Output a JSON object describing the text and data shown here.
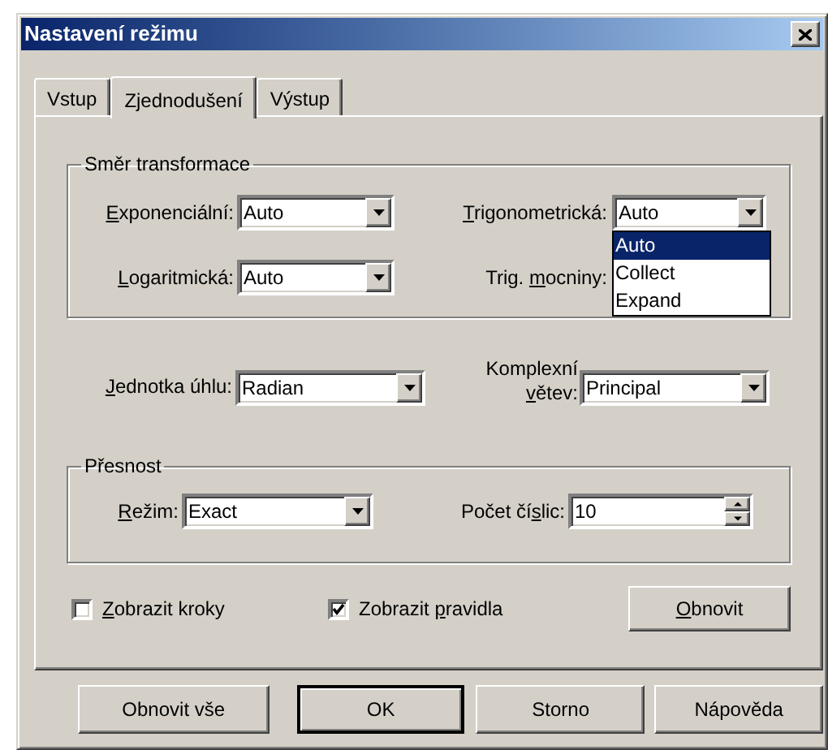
{
  "window": {
    "title": "Nastavení režimu"
  },
  "tabs": [
    {
      "label": "Vstup",
      "selected": false
    },
    {
      "label": "Zjednodušení",
      "selected": true
    },
    {
      "label": "Výstup",
      "selected": false
    }
  ],
  "transform_group": {
    "title": "Směr transformace",
    "exponential": {
      "label": {
        "key": "E",
        "post": "xponenciální:"
      },
      "value": "Auto"
    },
    "trigonometric": {
      "label": {
        "key": "T",
        "post": "rigonometrická:"
      },
      "value": "Auto",
      "expanded": true,
      "options": [
        {
          "label": "Auto",
          "selected": true
        },
        {
          "label": "Collect",
          "selected": false
        },
        {
          "label": "Expand",
          "selected": false
        }
      ]
    },
    "logarithmic": {
      "label": {
        "key": "L",
        "post": "ogaritmická:"
      },
      "value": "Auto"
    },
    "trig_powers": {
      "label": {
        "pre": "Trig. ",
        "key": "m",
        "post": "ocniny:"
      }
    }
  },
  "angle_unit": {
    "label": {
      "key": "J",
      "post": "ednotka úhlu:"
    },
    "value": "Radian"
  },
  "complex_branch": {
    "label": {
      "pre": "Komplexní ",
      "key": "v",
      "post": "ětev:"
    },
    "value": "Principal"
  },
  "precision_group": {
    "title": "Přesnost",
    "mode": {
      "label": {
        "key": "R",
        "post": "ežim:"
      },
      "value": "Exact"
    },
    "digits": {
      "label": {
        "pre": "Počet čí",
        "key": "s",
        "post": "lic:"
      },
      "value": "10"
    }
  },
  "checkboxes": [
    {
      "label": {
        "key": "Z",
        "post": "obrazit kroky"
      },
      "checked": false
    },
    {
      "label": {
        "pre": "Zobrazit ",
        "key": "p",
        "post": "ravidla"
      },
      "checked": true
    }
  ],
  "reset_button": {
    "label": {
      "key": "O",
      "post": "bnovit"
    }
  },
  "buttons": [
    {
      "label": "Obnovit vše",
      "default": false
    },
    {
      "label": "OK",
      "default": true
    },
    {
      "label": "Storno",
      "default": false
    },
    {
      "label": "Nápověda",
      "default": false
    }
  ]
}
